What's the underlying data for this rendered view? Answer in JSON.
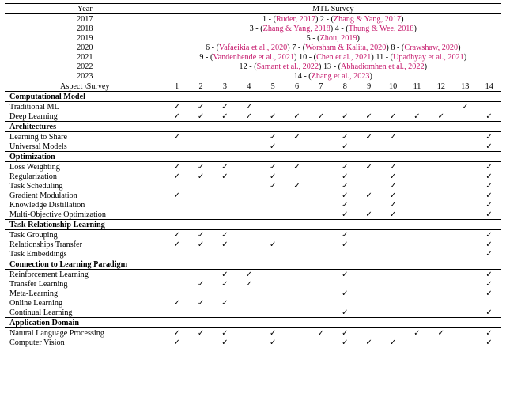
{
  "header": {
    "year_label": "Year",
    "survey_label": "MTL Survey",
    "aspect_label": "Aspect \\Survey"
  },
  "years": {
    "y2017": "2017",
    "y2018": "2018",
    "y2019": "2019",
    "y2020": "2020",
    "y2021": "2021",
    "y2022": "2022",
    "y2023": "2023"
  },
  "refs": {
    "r1_pre": "1 - (",
    "r1_txt": "Ruder, 2017",
    "r1_post": ") ",
    "r2_pre": "2 - (",
    "r2_txt": "Zhang & Yang, 2017",
    "r2_post": ")",
    "r3_pre": "3 - (",
    "r3_txt": "Zhang & Yang, 2018",
    "r3_post": ") ",
    "r4_pre": "4 - (",
    "r4_txt": "Thung & Wee, 2018",
    "r4_post": ")",
    "r5_pre": "5 - (",
    "r5_txt": "Zhou, 2019",
    "r5_post": ")",
    "r6_pre": "6 - (",
    "r6_txt": "Vafaeikia et al., 2020",
    "r6_post": ") ",
    "r7_pre": "7 - (",
    "r7_txt": "Worsham & Kalita, 2020",
    "r7_post": ") ",
    "r8_pre": "8 - (",
    "r8_txt": "Crawshaw, 2020",
    "r8_post": ")",
    "r9_pre": "9 - (",
    "r9_txt": "Vandenhende et al., 2021",
    "r9_post": ") ",
    "r10_pre": "10 - (",
    "r10_txt": "Chen et al., 2021",
    "r10_post": ") ",
    "r11_pre": "11 - (",
    "r11_txt": "Upadhyay et al., 2021",
    "r11_post": ")",
    "r12_pre": "12 - (",
    "r12_txt": "Samant et al., 2022",
    "r12_post": ") ",
    "r13_pre": "13 - (",
    "r13_txt": "Abhadiomhen et al., 2022",
    "r13_post": ")",
    "r14_pre": "14 - (",
    "r14_txt": "Zhang et al., 2023",
    "r14_post": ")"
  },
  "cols": {
    "c1": "1",
    "c2": "2",
    "c3": "3",
    "c4": "4",
    "c5": "5",
    "c6": "6",
    "c7": "7",
    "c8": "8",
    "c9": "9",
    "c10": "10",
    "c11": "11",
    "c12": "12",
    "c13": "13",
    "c14": "14"
  },
  "groups": {
    "comp": "Computational Model",
    "arch": "Architectures",
    "opt": "Optimization",
    "trl": "Task Relationship Learning",
    "clp": "Connection to Learning Paradigm",
    "app": "Application Domain"
  },
  "rows": {
    "trad": "Traditional ML",
    "deep": "Deep Learning",
    "lts": "Learning to Share",
    "uni": "Universal Models",
    "lw": "Loss Weighting",
    "reg": "Regularization",
    "ts": "Task Scheduling",
    "gm": "Gradient Modulation",
    "kd": "Knowledge Distillation",
    "moo": "Multi-Objective Optimization",
    "tg": "Task Grouping",
    "rt": "Relationships Transfer",
    "te": "Task Embeddings",
    "rl": "Reinforcement Learning",
    "tl": "Transfer Learning",
    "ml": "Meta-Learning",
    "ol": "Online Learning",
    "cl": "Continual Learning",
    "nlp": "Natural Language Processing",
    "cv": "Computer Vision"
  },
  "checks": {
    "trad": {
      "c1": "✓",
      "c2": "✓",
      "c3": "✓",
      "c4": "✓",
      "c13": "✓"
    },
    "deep": {
      "c1": "✓",
      "c2": "✓",
      "c3": "✓",
      "c4": "✓",
      "c5": "✓",
      "c6": "✓",
      "c7": "✓",
      "c8": "✓",
      "c9": "✓",
      "c10": "✓",
      "c11": "✓",
      "c12": "✓",
      "c14": "✓"
    },
    "lts": {
      "c1": "✓",
      "c5": "✓",
      "c6": "✓",
      "c8": "✓",
      "c9": "✓",
      "c10": "✓",
      "c14": "✓"
    },
    "uni": {
      "c5": "✓",
      "c8": "✓",
      "c14": "✓"
    },
    "lw": {
      "c1": "✓",
      "c2": "✓",
      "c3": "✓",
      "c5": "✓",
      "c6": "✓",
      "c8": "✓",
      "c9": "✓",
      "c10": "✓",
      "c14": "✓"
    },
    "reg": {
      "c1": "✓",
      "c2": "✓",
      "c3": "✓",
      "c5": "✓",
      "c8": "✓",
      "c10": "✓",
      "c14": "✓"
    },
    "ts": {
      "c5": "✓",
      "c6": "✓",
      "c8": "✓",
      "c10": "✓",
      "c14": "✓"
    },
    "gm": {
      "c1": "✓",
      "c8": "✓",
      "c9": "✓",
      "c10": "✓",
      "c14": "✓"
    },
    "kd": {
      "c8": "✓",
      "c10": "✓",
      "c14": "✓"
    },
    "moo": {
      "c8": "✓",
      "c9": "✓",
      "c10": "✓",
      "c14": "✓"
    },
    "tg": {
      "c1": "✓",
      "c2": "✓",
      "c3": "✓",
      "c8": "✓",
      "c14": "✓"
    },
    "rt": {
      "c1": "✓",
      "c2": "✓",
      "c3": "✓",
      "c5": "✓",
      "c8": "✓",
      "c14": "✓"
    },
    "te": {
      "c14": "✓"
    },
    "rl": {
      "c3": "✓",
      "c4": "✓",
      "c8": "✓",
      "c14": "✓"
    },
    "tl": {
      "c2": "✓",
      "c3": "✓",
      "c4": "✓",
      "c14": "✓"
    },
    "ml": {
      "c8": "✓",
      "c14": "✓"
    },
    "ol": {
      "c1": "✓",
      "c2": "✓",
      "c3": "✓"
    },
    "cl": {
      "c8": "✓",
      "c14": "✓"
    },
    "nlp": {
      "c1": "✓",
      "c2": "✓",
      "c3": "✓",
      "c5": "✓",
      "c7": "✓",
      "c8": "✓",
      "c11": "✓",
      "c12": "✓",
      "c14": "✓"
    },
    "cv": {
      "c1": "✓",
      "c3": "✓",
      "c5": "✓",
      "c8": "✓",
      "c9": "✓",
      "c10": "✓",
      "c14": "✓"
    }
  }
}
